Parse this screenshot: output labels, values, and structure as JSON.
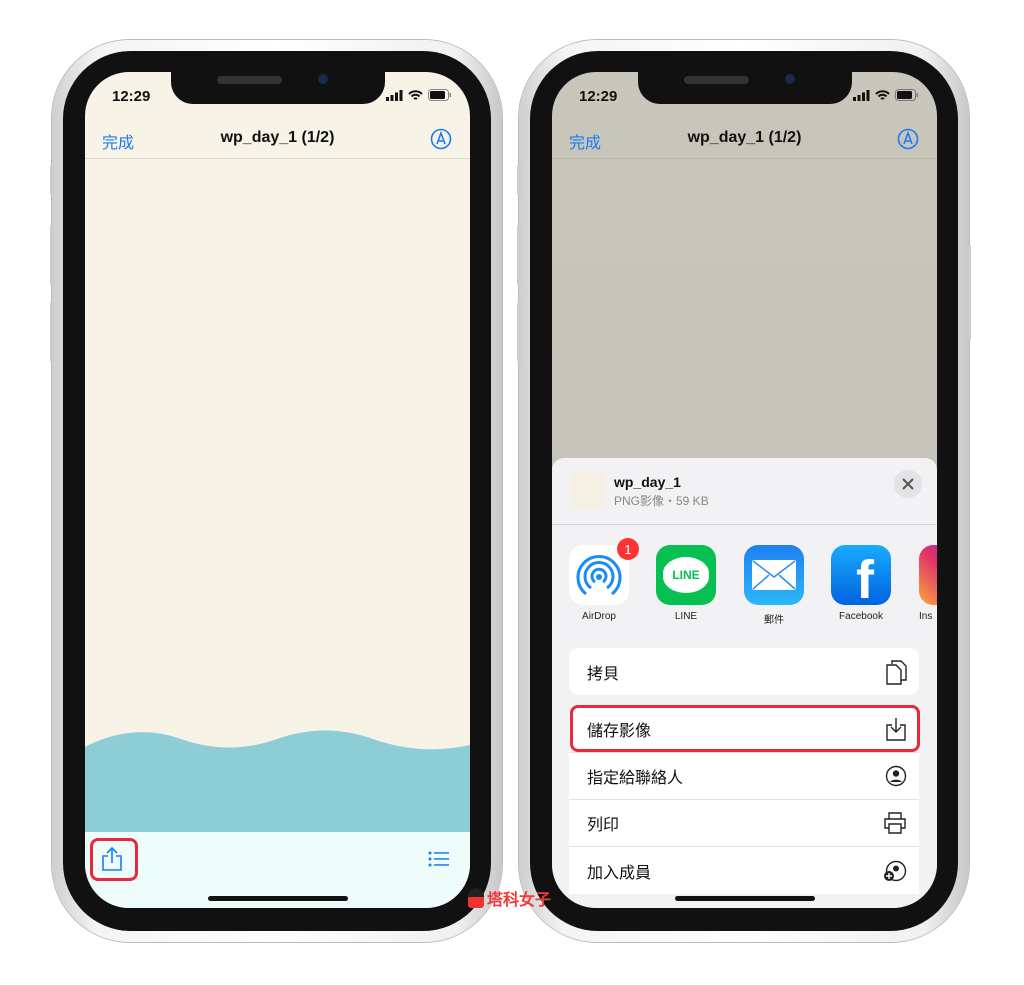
{
  "status": {
    "time": "12:29"
  },
  "left": {
    "nav": {
      "done": "完成",
      "title": "wp_day_1 (1/2)"
    },
    "toolbar": {
      "share": "share-icon",
      "list": "list-icon"
    }
  },
  "right": {
    "nav": {
      "done": "完成",
      "title": "wp_day_1 (1/2)"
    },
    "sheet": {
      "file_name": "wp_day_1",
      "file_info": "PNG影像・59 KB",
      "apps": [
        {
          "label": "AirDrop",
          "badge": "1"
        },
        {
          "label": "LINE",
          "icon_text": "LINE"
        },
        {
          "label": "郵件"
        },
        {
          "label": "Facebook"
        },
        {
          "label": "Ins"
        }
      ],
      "actions": [
        {
          "label": "拷貝",
          "icon": "copy-icon"
        },
        {
          "label": "儲存影像",
          "icon": "save-icon"
        },
        {
          "label": "指定給聯絡人",
          "icon": "contact-icon"
        },
        {
          "label": "列印",
          "icon": "print-icon"
        },
        {
          "label": "加入成員",
          "icon": "add-member-icon"
        }
      ]
    }
  },
  "watermark": "塔科女子",
  "colors": {
    "accent": "#1a7cf5",
    "highlight": "#e8283b",
    "wave": "#8dced6",
    "paper": "#f7f3e7"
  }
}
